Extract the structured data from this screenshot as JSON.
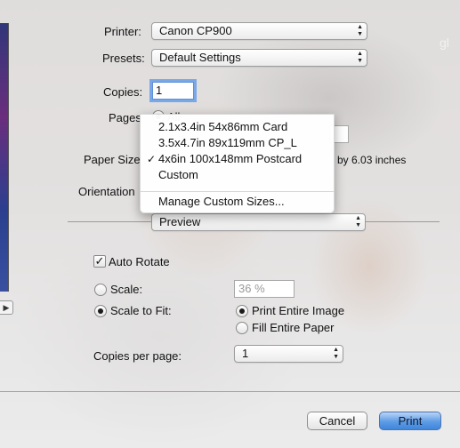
{
  "printer": {
    "label": "Printer:",
    "value": "Canon CP900"
  },
  "presets": {
    "label": "Presets:",
    "value": "Default Settings"
  },
  "copies": {
    "label": "Copies:",
    "value": "1"
  },
  "pages": {
    "label": "Pages",
    "option": "All"
  },
  "paper_size": {
    "label": "Paper Size",
    "dimension_text": "by 6.03 inches"
  },
  "orientation": {
    "label": "Orientation"
  },
  "paper_size_menu": {
    "items": [
      {
        "label": "2.1x3.4in 54x86mm Card",
        "checked": false
      },
      {
        "label": "3.5x4.7in 89x119mm CP_L",
        "checked": false
      },
      {
        "label": "4x6in 100x148mm Postcard",
        "checked": true
      },
      {
        "label": "Custom",
        "checked": false
      }
    ],
    "manage": "Manage Custom Sizes...",
    "check_mark": "✓"
  },
  "section_popup": {
    "value": "Preview"
  },
  "auto_rotate": {
    "label": "Auto Rotate",
    "checked": true
  },
  "scale": {
    "label": "Scale:",
    "value": "36 %",
    "selected": false
  },
  "scale_to_fit": {
    "label": "Scale to Fit:",
    "selected": true
  },
  "print_entire_image": {
    "label": "Print Entire Image",
    "selected": true
  },
  "fill_entire_paper": {
    "label": "Fill Entire Paper",
    "selected": false
  },
  "copies_per_page": {
    "label": "Copies per page:",
    "value": "1"
  },
  "buttons": {
    "cancel": "Cancel",
    "print": "Print"
  },
  "watermark": "gl",
  "colors": {
    "accent": "#3f86db",
    "focus_ring": "#7aa8e6",
    "menu_bg": "#ffffff"
  }
}
